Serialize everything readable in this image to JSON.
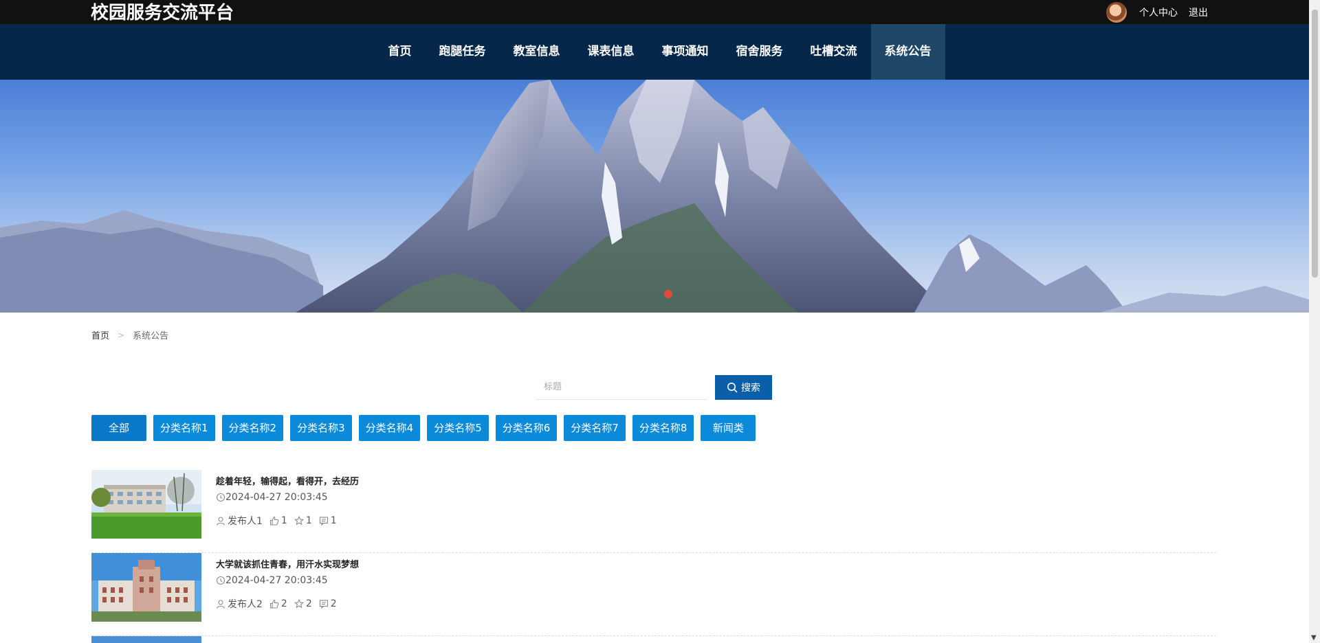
{
  "header": {
    "site_title": "校园服务交流平台",
    "links": {
      "personal_center": "个人中心",
      "logout": "退出"
    }
  },
  "nav": {
    "items": [
      {
        "label": "首页"
      },
      {
        "label": "跑腿任务"
      },
      {
        "label": "教室信息"
      },
      {
        "label": "课表信息"
      },
      {
        "label": "事项通知"
      },
      {
        "label": "宿舍服务"
      },
      {
        "label": "吐槽交流"
      },
      {
        "label": "系统公告"
      }
    ],
    "active_index": 7
  },
  "breadcrumb": {
    "home": "首页",
    "separator": ">",
    "current": "系统公告"
  },
  "search": {
    "placeholder": "标题",
    "value": "",
    "button_label": "搜索"
  },
  "categories": [
    "全部",
    "分类名称1",
    "分类名称2",
    "分类名称3",
    "分类名称4",
    "分类名称5",
    "分类名称6",
    "分类名称7",
    "分类名称8",
    "新闻类"
  ],
  "list": [
    {
      "title": "趁着年轻，输得起，看得开，去经历",
      "time": "2024-04-27 20:03:45",
      "author": "发布人1",
      "likes": "1",
      "favorites": "1",
      "comments": "1"
    },
    {
      "title": "大学就该抓住青春，用汗水实现梦想",
      "time": "2024-04-27 20:03:45",
      "author": "发布人2",
      "likes": "2",
      "favorites": "2",
      "comments": "2"
    }
  ],
  "icons": {
    "avatar": "user-avatar",
    "search": "search-icon",
    "time": "clock-icon",
    "author": "user-icon",
    "likes": "thumbs-up-icon",
    "favorites": "star-icon",
    "comments": "comment-icon"
  },
  "colors": {
    "topbar": "#111111",
    "nav": "#05284a",
    "nav_active": "#1e4768",
    "search_button": "#0a5fa8",
    "category_button": "#0a8ad8"
  }
}
